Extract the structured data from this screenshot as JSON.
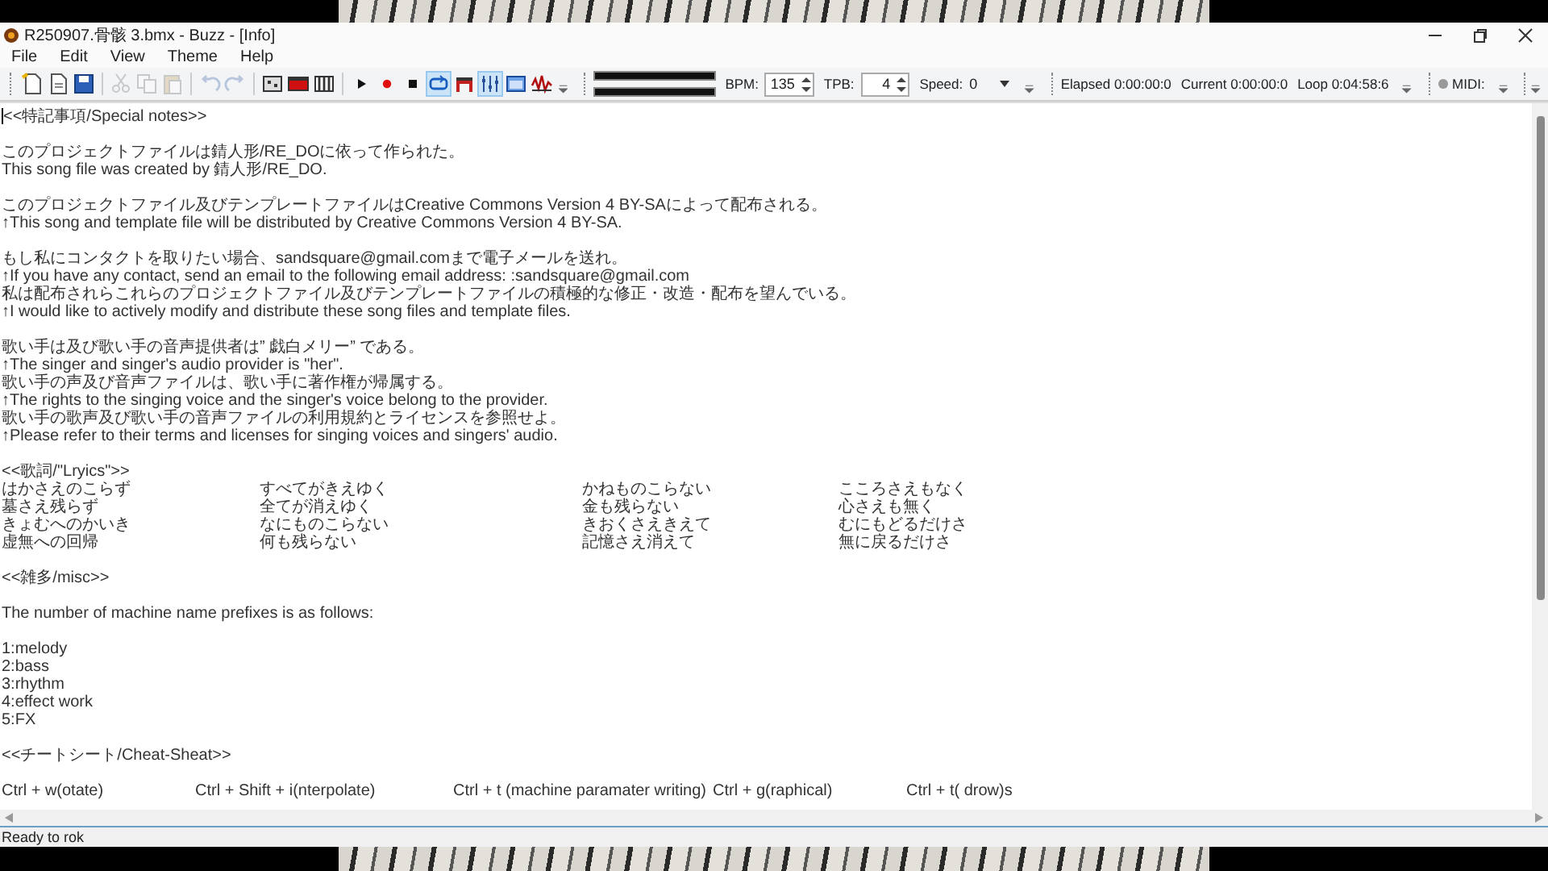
{
  "window": {
    "title": "R250907.骨骸 3.bmx - Buzz - [Info]"
  },
  "menu": [
    "File",
    "Edit",
    "View",
    "Theme",
    "Help"
  ],
  "toolbar": {
    "groups": [
      [
        {
          "kind": "new",
          "disabled": false,
          "pressed": false
        },
        {
          "kind": "open",
          "disabled": false,
          "pressed": false
        },
        {
          "kind": "save",
          "disabled": false,
          "pressed": false
        }
      ],
      [
        {
          "kind": "cut",
          "disabled": true,
          "pressed": false
        },
        {
          "kind": "copy",
          "disabled": true,
          "pressed": false
        },
        {
          "kind": "paste",
          "disabled": true,
          "pressed": false
        }
      ],
      [
        {
          "kind": "undo",
          "disabled": true,
          "pressed": false
        },
        {
          "kind": "redo",
          "disabled": true,
          "pressed": false
        }
      ],
      [
        {
          "kind": "machines",
          "disabled": false,
          "pressed": false
        },
        {
          "kind": "pattern",
          "disabled": false,
          "pressed": false
        },
        {
          "kind": "sequence",
          "disabled": false,
          "pressed": false
        }
      ],
      [
        {
          "kind": "play",
          "disabled": false,
          "pressed": false
        },
        {
          "kind": "record",
          "disabled": false,
          "pressed": false
        },
        {
          "kind": "stop",
          "disabled": false,
          "pressed": false
        },
        {
          "kind": "loop",
          "disabled": false,
          "pressed": true
        },
        {
          "kind": "arch",
          "disabled": false,
          "pressed": false
        },
        {
          "kind": "mixer",
          "disabled": false,
          "pressed": true
        },
        {
          "kind": "window",
          "disabled": false,
          "pressed": false
        },
        {
          "kind": "analyzer",
          "disabled": false,
          "pressed": false
        }
      ]
    ]
  },
  "transport": {
    "bpm_label": "BPM:",
    "bpm": "135",
    "tpb_label": "TPB:",
    "tpb": "4",
    "speed_label": "Speed:",
    "speed": "0",
    "elapsed": "Elapsed 0:00:00:0",
    "current": "Current 0:00:00:0",
    "loop": "Loop 0:04:58:6",
    "midi_label": "MIDI:"
  },
  "document": {
    "blocks": [
      {
        "kind": "heading",
        "text": "<<特記事項/Special notes>>"
      },
      {
        "kind": "paragraph",
        "lines": [
          "このプロジェクトファイルは錆人形/RE_DOに依って作られた。",
          "This song file was created by 錆人形/RE_DO."
        ]
      },
      {
        "kind": "paragraph",
        "lines": [
          "このプロジェクトファイル及びテンプレートファイルはCreative Commons Version 4 BY-SAによって配布される。",
          "↑This song and template file will be distributed by Creative Commons Version 4 BY-SA."
        ]
      },
      {
        "kind": "paragraph",
        "lines": [
          "もし私にコンタクトを取りたい場合、sandsquare@gmail.comまで電子メールを送れ。",
          "↑If you have any contact, send an email to the following email address: :sandsquare@gmail.com",
          "私は配布されらこれらのプロジェクトファイル及びテンプレートファイルの積極的な修正・改造・配布を望んでいる。",
          "↑I would like to actively modify and distribute these song files and template files."
        ]
      },
      {
        "kind": "paragraph",
        "lines": [
          "歌い手は及び歌い手の音声提供者は” 戯白メリー” である。",
          "↑The singer and singer's audio provider is \"her\".",
          "歌い手の声及び音声ファイルは、歌い手に著作権が帰属する。",
          "↑The rights to the singing voice and the singer's voice belong to the provider.",
          "歌い手の歌声及び歌い手の音声ファイルの利用規約とライセンスを参照せよ。",
          "↑Please refer to their terms and licenses for singing voices and singers' audio."
        ]
      },
      {
        "kind": "columns",
        "heading": "<<歌詞/\"Lryics\">>",
        "rows": [
          [
            "はかさえのこらず",
            "すべてがきえゆく",
            "かねものこらない",
            "こころさえもなく"
          ],
          [
            "墓さえ残らず",
            "全てが消えゆく",
            "金も残らない",
            "心さえも無く"
          ],
          [
            "きょむへのかいき",
            "なにものこらない",
            "きおくさえきえて",
            "むにもどるだけさ"
          ],
          [
            "虚無への回帰",
            "何も残らない",
            "記憶さえ消えて",
            "無に戻るだけさ"
          ]
        ]
      },
      {
        "kind": "heading",
        "text": "<<雑多/misc>>"
      },
      {
        "kind": "paragraph",
        "lines": [
          "The number of machine name prefixes is as follows:"
        ]
      },
      {
        "kind": "paragraph",
        "lines": [
          "1:melody",
          "2:bass",
          "3:rhythm",
          "4:effect work",
          "5:FX"
        ]
      },
      {
        "kind": "heading",
        "text": "<<チートシート/Cheat-Sheat>>"
      },
      {
        "kind": "shortcuts",
        "items": [
          "Ctrl + w(otate)",
          "Ctrl + Shift + i(nterpolate)",
          "Ctrl + t (machine paramater writing)",
          "Ctrl + g(raphical)",
          "Ctrl + t( drow)s"
        ]
      }
    ]
  },
  "status_bar": "Ready to rok"
}
